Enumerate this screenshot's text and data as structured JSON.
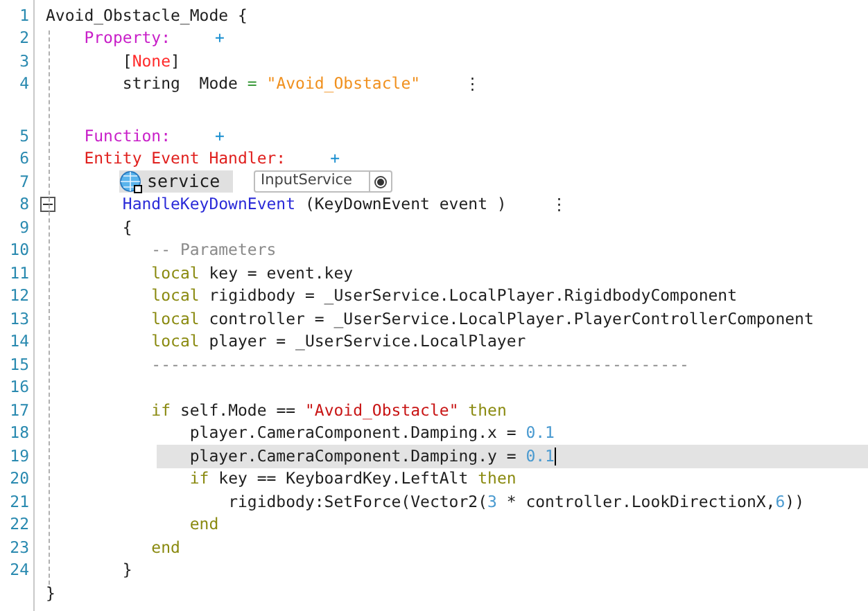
{
  "editor": {
    "lines": [
      {
        "kind": "code",
        "number": "1",
        "selected": false,
        "tokens": [
          {
            "kind": "plain",
            "text": "Avoid_Obstacle_Mode {"
          }
        ]
      },
      {
        "kind": "code",
        "number": "2",
        "selected": false,
        "tokens": [
          {
            "kind": "section",
            "text": "    Property:"
          },
          {
            "kind": "plus",
            "text": "+"
          }
        ]
      },
      {
        "kind": "code",
        "number": "3",
        "selected": false,
        "tokens": [
          {
            "kind": "plain",
            "text": "        ["
          },
          {
            "kind": "attr",
            "text": "None"
          },
          {
            "kind": "plain",
            "text": "]"
          }
        ]
      },
      {
        "kind": "code",
        "number": "4",
        "selected": false,
        "tokens": [
          {
            "kind": "plain",
            "text": "        string  Mode "
          },
          {
            "kind": "op",
            "text": "="
          },
          {
            "kind": "string",
            "text": " \"Avoid_Obstacle\""
          },
          {
            "kind": "more",
            "text": "⋮"
          }
        ]
      },
      {
        "kind": "gap"
      },
      {
        "kind": "code",
        "number": "5",
        "selected": false,
        "tokens": [
          {
            "kind": "section",
            "text": "    Function:"
          },
          {
            "kind": "plus",
            "text": "+"
          }
        ]
      },
      {
        "kind": "code",
        "number": "6",
        "selected": false,
        "tokens": [
          {
            "kind": "handler",
            "text": "    Entity Event Handler:"
          },
          {
            "kind": "plus",
            "text": "+"
          }
        ]
      },
      {
        "kind": "service",
        "number": "7",
        "label": "service",
        "value": "InputService"
      },
      {
        "kind": "code",
        "number": "8",
        "selected": false,
        "fold": true,
        "tokens": [
          {
            "kind": "func",
            "text": "        HandleKeyDownEvent"
          },
          {
            "kind": "plain",
            "text": " (KeyDownEvent event )"
          },
          {
            "kind": "more",
            "text": "⋮"
          }
        ]
      },
      {
        "kind": "code",
        "number": "9",
        "selected": false,
        "tokens": [
          {
            "kind": "plain",
            "text": "        {"
          }
        ]
      },
      {
        "kind": "code",
        "number": "10",
        "selected": false,
        "tokens": [
          {
            "kind": "comment",
            "text": "           -- Parameters"
          }
        ]
      },
      {
        "kind": "code",
        "number": "11",
        "selected": false,
        "tokens": [
          {
            "kind": "keyword",
            "text": "           local"
          },
          {
            "kind": "plain",
            "text": " key = event.key"
          }
        ]
      },
      {
        "kind": "code",
        "number": "12",
        "selected": false,
        "tokens": [
          {
            "kind": "keyword",
            "text": "           local"
          },
          {
            "kind": "plain",
            "text": " rigidbody = _UserService.LocalPlayer.RigidbodyComponent"
          }
        ]
      },
      {
        "kind": "code",
        "number": "13",
        "selected": false,
        "tokens": [
          {
            "kind": "keyword",
            "text": "           local"
          },
          {
            "kind": "plain",
            "text": " controller = _UserService.LocalPlayer.PlayerControllerComponent"
          }
        ]
      },
      {
        "kind": "code",
        "number": "14",
        "selected": false,
        "tokens": [
          {
            "kind": "keyword",
            "text": "           local"
          },
          {
            "kind": "plain",
            "text": " player = _UserService.LocalPlayer"
          }
        ]
      },
      {
        "kind": "code",
        "number": "15",
        "selected": false,
        "tokens": [
          {
            "kind": "comment",
            "text": "           --------------------------------------------------------"
          }
        ]
      },
      {
        "kind": "code",
        "number": "16",
        "selected": false
      },
      {
        "kind": "code",
        "number": "17",
        "selected": false,
        "tokens": [
          {
            "kind": "keyword",
            "text": "           if"
          },
          {
            "kind": "plain",
            "text": " self.Mode == "
          },
          {
            "kind": "redstring",
            "text": "\"Avoid_Obstacle\""
          },
          {
            "kind": "keyword",
            "text": " then"
          }
        ]
      },
      {
        "kind": "code",
        "number": "18",
        "selected": false,
        "tokens": [
          {
            "kind": "plain",
            "text": "               player.CameraComponent.Damping.x = "
          },
          {
            "kind": "number",
            "text": "0.1"
          }
        ]
      },
      {
        "kind": "code",
        "number": "19",
        "selected": true,
        "tokens": [
          {
            "kind": "plain",
            "text": "               player.CameraComponent.Damping.y = "
          },
          {
            "kind": "number",
            "text": "0.1"
          }
        ]
      },
      {
        "kind": "code",
        "number": "20",
        "selected": false,
        "tokens": [
          {
            "kind": "keyword",
            "text": "               if"
          },
          {
            "kind": "plain",
            "text": " key == KeyboardKey.LeftAlt "
          },
          {
            "kind": "keyword",
            "text": "then"
          }
        ]
      },
      {
        "kind": "code",
        "number": "21",
        "selected": false,
        "tokens": [
          {
            "kind": "plain",
            "text": "                   rigidbody:SetForce(Vector2("
          },
          {
            "kind": "number",
            "text": "3"
          },
          {
            "kind": "plain",
            "text": " * controller.LookDirectionX,"
          },
          {
            "kind": "number",
            "text": "6"
          },
          {
            "kind": "plain",
            "text": "))"
          }
        ]
      },
      {
        "kind": "code",
        "number": "22",
        "selected": false,
        "tokens": [
          {
            "kind": "keyword",
            "text": "               end"
          }
        ]
      },
      {
        "kind": "code",
        "number": "23",
        "selected": false,
        "tokens": [
          {
            "kind": "keyword",
            "text": "           end"
          }
        ]
      },
      {
        "kind": "code",
        "number": "24",
        "selected": false,
        "tokens": [
          {
            "kind": "plain",
            "text": "        }"
          }
        ]
      },
      {
        "kind": "code",
        "selected": false,
        "tokens": [
          {
            "kind": "plain",
            "text": "}"
          }
        ]
      }
    ]
  }
}
